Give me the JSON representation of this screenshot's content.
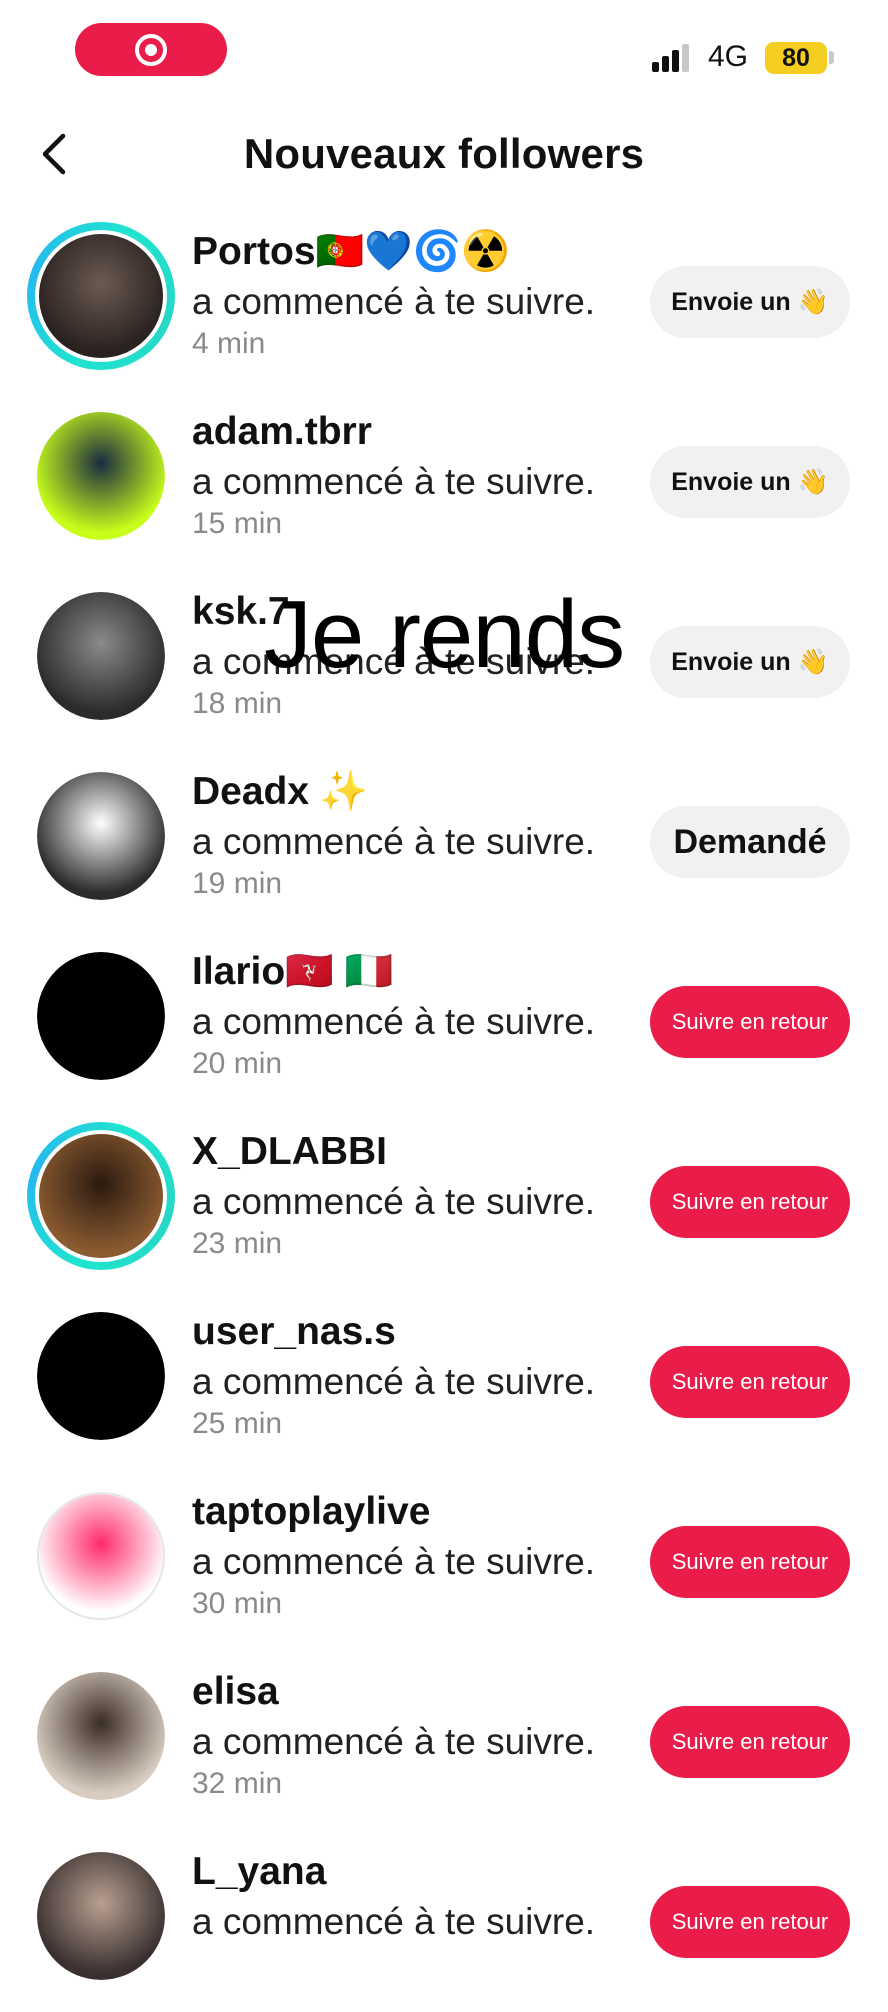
{
  "status": {
    "network": "4G",
    "battery": "80"
  },
  "header": {
    "title": "Nouveaux followers"
  },
  "followers": [
    {
      "username": "Portos🇵🇹💙🌀☢️",
      "action": "a commencé à te suivre.",
      "time": "4 min",
      "button": "Envoie un 👋",
      "button_style": "wave",
      "story_ring": true,
      "avatar_colors": [
        "#2a2220",
        "#6b5a52"
      ]
    },
    {
      "username": "adam.tbrr",
      "action": "a commencé à te suivre.",
      "time": "15 min",
      "button": "Envoie un 👋",
      "button_style": "wave",
      "story_ring": false,
      "avatar_colors": [
        "#c8ff1a",
        "#1a2a40"
      ]
    },
    {
      "username": "ksk.7",
      "action": "a commencé à te suivre.",
      "time": "18 min",
      "button": "Envoie un 👋",
      "button_style": "wave",
      "story_ring": false,
      "avatar_colors": [
        "#2b2b2b",
        "#8a8a8a"
      ]
    },
    {
      "username": "Deadx ✨",
      "action": "a commencé à te suivre.",
      "time": "19 min",
      "button": "Demandé",
      "button_style": "requested",
      "story_ring": false,
      "avatar_colors": [
        "#2c2c2c",
        "#ffffff"
      ]
    },
    {
      "username": "Ilario🇮🇲 🇮🇹",
      "action": "a commencé à te suivre.",
      "time": "20 min",
      "button": "Suivre en retour",
      "button_style": "red",
      "story_ring": false,
      "avatar_colors": [
        "#000000",
        "#000000"
      ]
    },
    {
      "username": "X_DLABBI",
      "action": "a commencé à te suivre.",
      "time": "23 min",
      "button": "Suivre en retour",
      "button_style": "red",
      "story_ring": true,
      "avatar_colors": [
        "#8a5a30",
        "#2a1a10"
      ]
    },
    {
      "username": "user_nas.s",
      "action": "a commencé à te suivre.",
      "time": "25 min",
      "button": "Suivre en retour",
      "button_style": "red",
      "story_ring": false,
      "avatar_colors": [
        "#000000",
        "#000000"
      ]
    },
    {
      "username": "taptoplaylive",
      "action": "a commencé à te suivre.",
      "time": "30 min",
      "button": "Suivre en retour",
      "button_style": "red",
      "story_ring": false,
      "avatar_colors": [
        "#ffffff",
        "#ff2a6a"
      ]
    },
    {
      "username": "elisa",
      "action": "a commencé à te suivre.",
      "time": "32 min",
      "button": "Suivre en retour",
      "button_style": "red",
      "story_ring": false,
      "avatar_colors": [
        "#d9ccc0",
        "#3a2c26"
      ]
    },
    {
      "username": "L_yana",
      "action": "a commencé à te suivre.",
      "time": "",
      "button": "Suivre en retour",
      "button_style": "red",
      "story_ring": false,
      "avatar_colors": [
        "#3a3030",
        "#b8a090"
      ]
    }
  ],
  "overlay_text": "Je rends"
}
